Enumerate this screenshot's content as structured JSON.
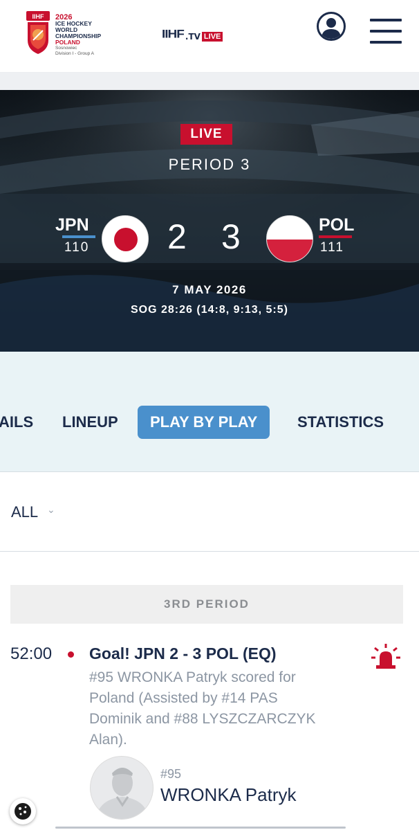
{
  "header": {
    "logo": {
      "year": "2026",
      "line1": "ICE HOCKEY",
      "line2": "WORLD",
      "line3": "CHAMPIONSHIP",
      "country": "POLAND",
      "city": "Sosnowiec",
      "division": "Division I - Group A",
      "crest_text": "IIHF"
    },
    "tv": {
      "brand": "IIHF",
      "dot": ".TV",
      "live": "LIVE"
    },
    "user_icon": "user-icon",
    "menu_icon": "hamburger-icon"
  },
  "game": {
    "status": "LIVE",
    "period": "PERIOD 3",
    "home": {
      "code": "JPN",
      "record": "110",
      "score": "2",
      "color": "#4a90cc"
    },
    "away": {
      "code": "POL",
      "record": "111",
      "score": "3",
      "color": "#c8102e"
    },
    "date": "7 MAY 2026",
    "sog": "SOG 28:26 (14:8, 9:13, 5:5)"
  },
  "tabs": [
    {
      "label": "AILS",
      "active": false
    },
    {
      "label": "LINEUP",
      "active": false
    },
    {
      "label": "PLAY BY PLAY",
      "active": true
    },
    {
      "label": "STATISTICS",
      "active": false
    }
  ],
  "filter": {
    "label": "ALL"
  },
  "period_header": "3RD PERIOD",
  "event": {
    "time": "52:00",
    "title": "Goal! JPN 2 - 3 POL (EQ)",
    "description": "#95 WRONKA Patryk scored for Poland (Assisted by #14 PAS Dominik and #88 LYSZCZARCZYK Alan).",
    "player_number": "#95",
    "player_name": "WRONKA Patryk",
    "icon": "siren-icon"
  },
  "colors": {
    "navy": "#1c2b4a",
    "accent_blue": "#4a90cc",
    "red": "#c8102e",
    "tab_bg": "#e9f3f6"
  }
}
